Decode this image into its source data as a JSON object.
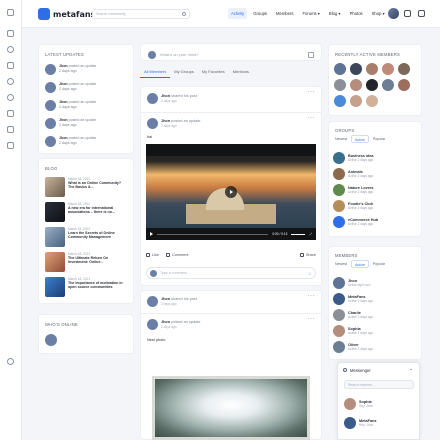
{
  "header": {
    "logo": "metafans",
    "search_placeholder": "Search community",
    "nav": [
      "Activity",
      "Groups",
      "Members",
      "Forums ▾",
      "Blog ▾",
      "Photos",
      "Shop ▾"
    ]
  },
  "latest_updates": {
    "title": "LATEST UPDATES",
    "items": [
      {
        "name": "Jhon",
        "action": "posted an update",
        "time": "2 days ago"
      },
      {
        "name": "Jhon",
        "action": "posted an update",
        "time": "2 days ago"
      },
      {
        "name": "Jhon",
        "action": "posted an update",
        "time": "2 days ago"
      },
      {
        "name": "Jhon",
        "action": "posted an update",
        "time": "2 days ago"
      },
      {
        "name": "Jhon",
        "action": "posted an update",
        "time": "2 days ago"
      }
    ]
  },
  "blog": {
    "title": "BLOG",
    "items": [
      {
        "date": "March 18, 2021",
        "title": "What is an Online Community? The Basics &..."
      },
      {
        "date": "March 18, 2021",
        "title": "A new era for international associations – there is no..."
      },
      {
        "date": "March 18, 2021",
        "title": "Learn the Secrets of Online Community Management"
      },
      {
        "date": "March 18, 2021",
        "title": "The Ultimate Return On Investment: Online..."
      },
      {
        "date": "March 18, 2021",
        "title": "The importance of motivation in open source communities"
      }
    ]
  },
  "whos_online": {
    "title": "WHO'S ONLINE"
  },
  "composer": {
    "placeholder": "What's on your mind?"
  },
  "tabs": [
    "All Members",
    "My Groups",
    "My Favorites",
    "Mentions"
  ],
  "posts": [
    {
      "name": "Jhon",
      "action": "shared his post",
      "time": "2 days ago"
    },
    {
      "name": "Jhon",
      "action": "posted an update",
      "time": "2 days ago",
      "text": "hai",
      "video_time": "0:00 / 0:13"
    },
    {
      "name": "Jhon",
      "action": "shared his post",
      "time": "2 days ago"
    },
    {
      "name": "Jhon",
      "action": "posted an update",
      "time": "2 days ago",
      "text": "Nest photo"
    }
  ],
  "post_actions": {
    "like": "Like",
    "comment": "Comment",
    "share": "Share",
    "comment_placeholder": "Type a comment..."
  },
  "recently_active": {
    "title": "RECENTLY ACTIVE MEMBERS"
  },
  "groups": {
    "title": "GROUPS",
    "filters": [
      "Newest",
      "Active",
      "Popular"
    ],
    "items": [
      {
        "name": "Business idea",
        "sub": "Active 2 days ago"
      },
      {
        "name": "Animals",
        "sub": "Active 2 days ago"
      },
      {
        "name": "Nature Lovers",
        "sub": "Active 2 days ago"
      },
      {
        "name": "Foodie's Club",
        "sub": "Active 2 days ago"
      },
      {
        "name": "eCommerce Hub",
        "sub": "Active 2 days ago"
      }
    ]
  },
  "members": {
    "title": "MEMBERS",
    "filters": [
      "Newest",
      "Active",
      "Popular"
    ],
    "items": [
      {
        "name": "Jhon",
        "sub": "Active right now"
      },
      {
        "name": "MetaFans",
        "sub": "Active 2 days ago"
      },
      {
        "name": "Charlie",
        "sub": "Active 2 days ago"
      },
      {
        "name": "Sophia",
        "sub": "Active 2 days ago"
      },
      {
        "name": "Oliver",
        "sub": "Active 2 days ago"
      }
    ]
  },
  "messenger": {
    "title": "Messenger",
    "search_placeholder": "Search member...",
    "items": [
      {
        "name": "Sophia",
        "sub": "Hey, Jhon"
      },
      {
        "name": "MetaFans",
        "sub": "Hey, Jhon"
      }
    ]
  },
  "colors": {
    "accent": "#2e6fe8",
    "background": "#f3f5f8"
  }
}
